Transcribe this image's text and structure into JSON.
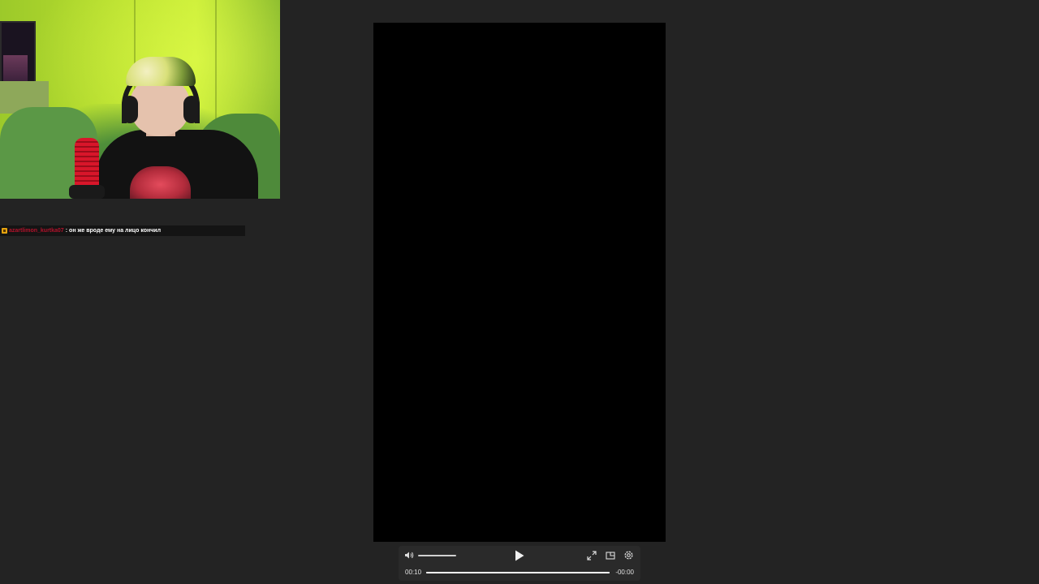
{
  "webcam": {
    "description_icon": "webcam-feed"
  },
  "chat": {
    "badge_icon": "moderator-badge-icon",
    "username": "azartlimon_kurtka07",
    "separator": ":",
    "message": "он же вроде ему на лицо кончил",
    "username_color": "#b3122b"
  },
  "player": {
    "controls": {
      "volume_icon": "speaker-icon",
      "play_icon": "play-icon",
      "fullscreen_icon": "expand-icon",
      "pip_icon": "picture-in-picture-icon",
      "settings_icon": "gear-icon",
      "volume_level": 1.0,
      "current_time": "00:10",
      "remaining_time": "-00:00",
      "progress": 1.0
    }
  },
  "colors": {
    "background": "#232323",
    "player_bg": "#000000",
    "controls_bg": "#2a2a2a"
  }
}
